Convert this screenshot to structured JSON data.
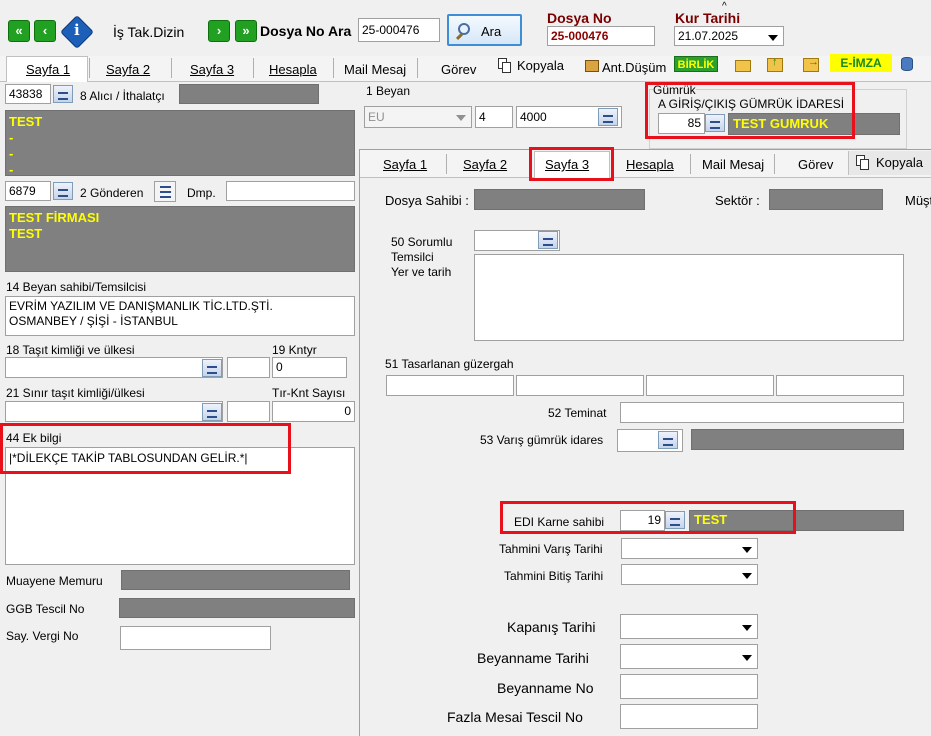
{
  "toolbar": {
    "is_tak_dizin": "İş Tak.Dizin",
    "dosya_no_ara_label": "Dosya No Ara",
    "search_value": "25-000476",
    "ara_button": "Ara",
    "dosya_no_title": "Dosya No",
    "dosya_no_value": "25-000476",
    "kur_tarihi_title": "Kur Tarihi",
    "kur_tarihi_value": "21.07.2025"
  },
  "main_tabs": {
    "sayfa1": "Sayfa 1",
    "sayfa2": "Sayfa 2",
    "sayfa3": "Sayfa 3",
    "hesapla": "Hesapla",
    "mail_mesaj": "Mail Mesaj",
    "gorev": "Görev",
    "kopyala": "Kopyala",
    "ant_dusum": "Ant.Düşüm",
    "birlik": "BİRLİK",
    "e_imza": "E-İMZA"
  },
  "left": {
    "alici_code": "43838",
    "alici_label": "8 Alıcı / İthalatçı",
    "alici_text": "TEST\n-\n-\n-",
    "gonderen_code": "6879",
    "gonderen_label": "2 Gönderen",
    "dmp_label": "Dmp.",
    "gonderen_text": "TEST FİRMASI\nTEST",
    "beyan_sahibi_label": "14 Beyan sahibi/Temsilcisi",
    "beyan_sahibi_text": "EVRİM YAZILIM VE DANIŞMANLIK TİC.LTD.ŞTİ.\nOSMANBEY / ŞİŞİ - İSTANBUL",
    "tasit_label": "18 Taşıt kimliği ve ülkesi",
    "kntyr_label": "19 Kntyr",
    "kntyr_value": "0",
    "sinir_label": "21 Sınır taşıt kimliği/ülkesi",
    "tir_label": "Tır-Knt Sayısı",
    "tir_value": "0",
    "ek_bilgi_label": "44 Ek bilgi",
    "ek_bilgi_text": "|*DİLEKÇE TAKİP TABLOSUNDAN GELİR.*|",
    "muayene_label": "Muayene Memuru",
    "ggb_label": "GGB Tescil No",
    "vergi_label": "Say. Vergi No"
  },
  "beyan": {
    "label": "1 Beyan",
    "v1": "EU",
    "v2": "4",
    "v3": "4000"
  },
  "gumruk": {
    "group_label": "Gümrük",
    "label": "A GİRİŞ/ÇIKIŞ GÜMRÜK İDARESİ",
    "code": "85",
    "name": "TEST GUMRUK"
  },
  "inner_tabs": {
    "sayfa1": "Sayfa 1",
    "sayfa2": "Sayfa 2",
    "sayfa3": "Sayfa 3",
    "hesapla": "Hesapla",
    "mail_mesaj": "Mail Mesaj",
    "gorev": "Görev",
    "kopyala": "Kopyala"
  },
  "inner": {
    "dosya_sahibi": "Dosya Sahibi :",
    "sektor": "Sektör :",
    "musteri": "Müşt",
    "sorumlu": "50 Sorumlu",
    "temsilci": "Temsilci",
    "yer_tarih": "Yer ve tarih",
    "guzergah": "51 Tasarlanan güzergah",
    "teminat": "52 Teminat",
    "varis_gumruk": "53 Varış gümrük idares",
    "edi_label": "EDI Karne sahibi",
    "edi_code": "19",
    "edi_name": "TEST",
    "tahmini_varis": "Tahmini Varış Tarihi",
    "tahmini_bitis": "Tahmini Bitiş Tarihi",
    "kapanis": "Kapanış Tarihi",
    "beyanname_tarihi": "Beyanname Tarihi",
    "beyanname_no": "Beyanname No",
    "fazla_mesai": "Fazla Mesai Tescil No"
  }
}
